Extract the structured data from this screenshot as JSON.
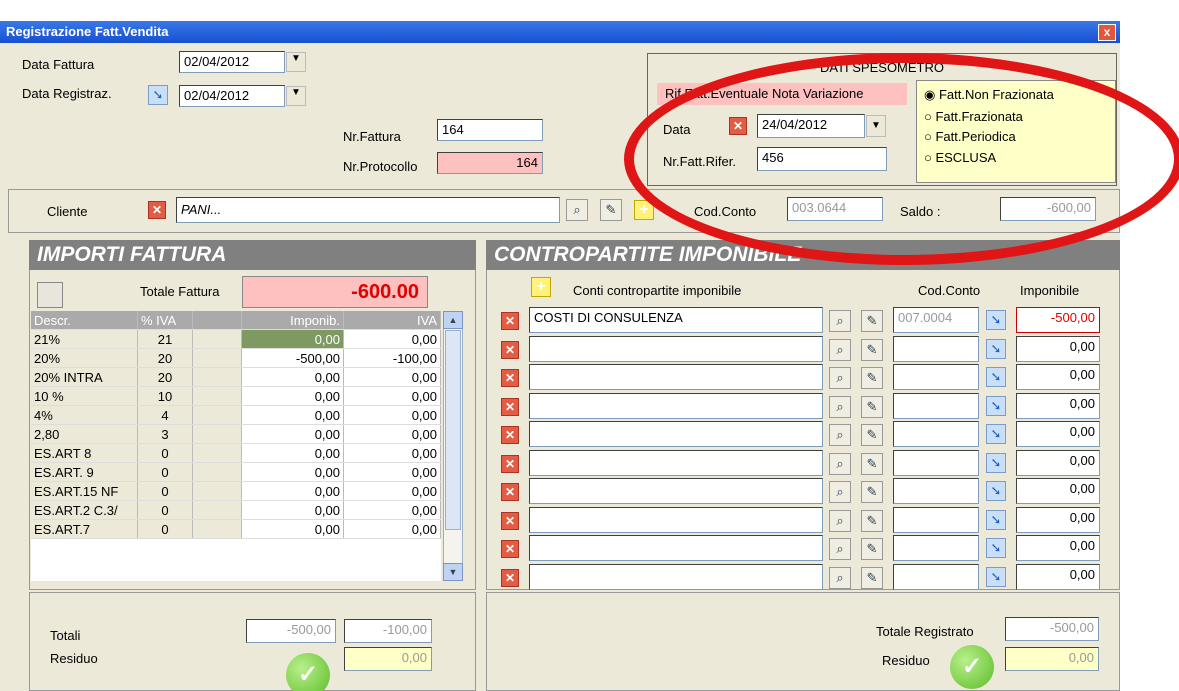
{
  "window": {
    "title": "Registrazione Fatt.Vendita",
    "close": "x"
  },
  "header": {
    "data_fattura_label": "Data Fattura",
    "data_fattura": "02/04/2012",
    "data_registraz_label": "Data Registraz.",
    "data_registraz": "02/04/2012",
    "nr_fattura_label": "Nr.Fattura",
    "nr_fattura": "164",
    "nr_protocollo_label": "Nr.Protocollo",
    "nr_protocollo": "164"
  },
  "spesometro": {
    "title": "DATI SPESOMETRO",
    "rif_label": "Rif.Fatt.Eventuale Nota Variazione",
    "data_label": "Data",
    "data": "24/04/2012",
    "nr_rifer_label": "Nr.Fatt.Rifer.",
    "nr_rifer": "456",
    "options": [
      "Fatt.Non Frazionata",
      "Fatt.Frazionata",
      "Fatt.Periodica",
      "ESCLUSA"
    ],
    "selected": "Fatt.Non Frazionata"
  },
  "cliente": {
    "label": "Cliente",
    "value": "PANI...",
    "cod_conto_label": "Cod.Conto",
    "cod_conto": "003.0644",
    "saldo_label": "Saldo :",
    "saldo": "-600,00"
  },
  "importi": {
    "title": "IMPORTI FATTURA",
    "totale_label": "Totale Fattura",
    "totale": "-600.00",
    "columns": [
      "Descr.",
      "% IVA",
      "",
      "Imponib.",
      "IVA"
    ],
    "rows": [
      {
        "descr": "21%",
        "iva_pct": "21",
        "imponib": "0,00",
        "iva": "0,00"
      },
      {
        "descr": "20%",
        "iva_pct": "20",
        "imponib": "-500,00",
        "iva": "-100,00"
      },
      {
        "descr": "20% INTRA",
        "iva_pct": "20",
        "imponib": "0,00",
        "iva": "0,00"
      },
      {
        "descr": "10 %",
        "iva_pct": "10",
        "imponib": "0,00",
        "iva": "0,00"
      },
      {
        "descr": "4%",
        "iva_pct": "4",
        "imponib": "0,00",
        "iva": "0,00"
      },
      {
        "descr": "2,80",
        "iva_pct": "3",
        "imponib": "0,00",
        "iva": "0,00"
      },
      {
        "descr": "ES.ART 8",
        "iva_pct": "0",
        "imponib": "0,00",
        "iva": "0,00"
      },
      {
        "descr": "ES.ART. 9",
        "iva_pct": "0",
        "imponib": "0,00",
        "iva": "0,00"
      },
      {
        "descr": "ES.ART.15 NF",
        "iva_pct": "0",
        "imponib": "0,00",
        "iva": "0,00"
      },
      {
        "descr": "ES.ART.2 C.3/",
        "iva_pct": "0",
        "imponib": "0,00",
        "iva": "0,00"
      },
      {
        "descr": "ES.ART.7",
        "iva_pct": "0",
        "imponib": "0,00",
        "iva": "0,00"
      }
    ],
    "totali_label": "Totali",
    "totali_imponib": "-500,00",
    "totali_iva": "-100,00",
    "residuo_label": "Residuo",
    "residuo": "0,00"
  },
  "contropartite": {
    "title": "CONTROPARTITE IMPONIBILE",
    "col_conti": "Conti contropartite imponibile",
    "col_cod": "Cod.Conto",
    "col_imp": "Imponibile",
    "rows": [
      {
        "conto": "COSTI DI CONSULENZA",
        "cod": "007.0004",
        "imp": "-500,00"
      },
      {
        "conto": "",
        "cod": "",
        "imp": "0,00"
      },
      {
        "conto": "",
        "cod": "",
        "imp": "0,00"
      },
      {
        "conto": "",
        "cod": "",
        "imp": "0,00"
      },
      {
        "conto": "",
        "cod": "",
        "imp": "0,00"
      },
      {
        "conto": "",
        "cod": "",
        "imp": "0,00"
      },
      {
        "conto": "",
        "cod": "",
        "imp": "0,00"
      },
      {
        "conto": "",
        "cod": "",
        "imp": "0,00"
      },
      {
        "conto": "",
        "cod": "",
        "imp": "0,00"
      },
      {
        "conto": "",
        "cod": "",
        "imp": "0,00"
      }
    ],
    "totale_label": "Totale Registrato",
    "totale": "-500,00",
    "residuo_label": "Residuo",
    "residuo": "0,00"
  },
  "colors": {
    "titlebar": "#1650d0",
    "pink": "#ffc0c0",
    "yellow": "#ffffc8",
    "annotation": "#e01515",
    "header_gray": "#808080"
  }
}
